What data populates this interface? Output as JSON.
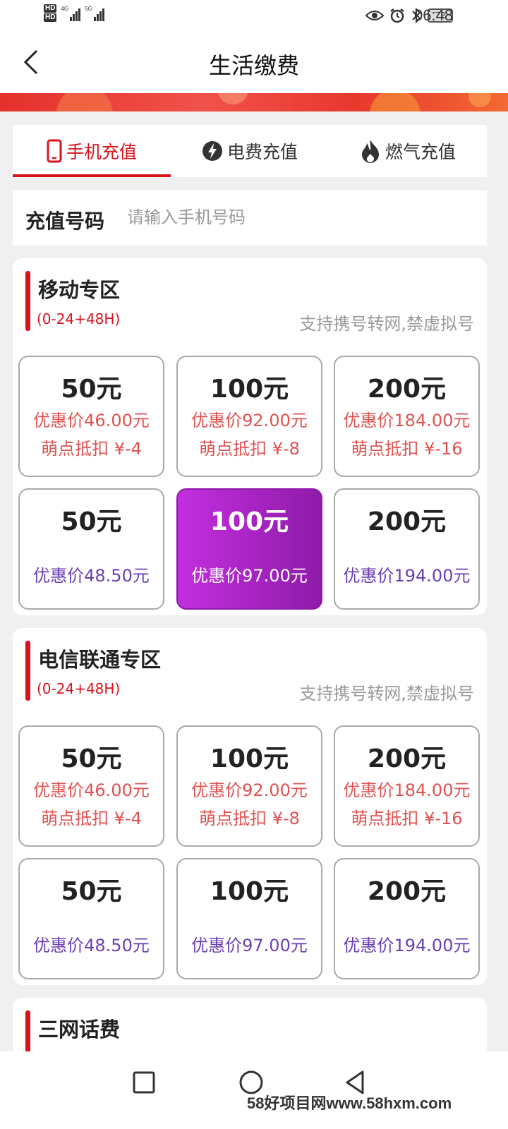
{
  "status": {
    "hd1": "HD",
    "hd2": "HD",
    "net1": "4G",
    "net2": "5G",
    "battery": "72",
    "time": "06:48"
  },
  "header": {
    "title": "生活缴费"
  },
  "tabs": [
    {
      "label": "手机充值",
      "icon": "phone-icon",
      "active": true
    },
    {
      "label": "电费充值",
      "icon": "lightning-icon",
      "active": false
    },
    {
      "label": "燃气充值",
      "icon": "flame-icon",
      "active": false
    }
  ],
  "recharge": {
    "label": "充值号码",
    "placeholder": "请输入手机号码",
    "value": ""
  },
  "sections": [
    {
      "title": "移动专区",
      "subtitle": "(0-24+48H)",
      "note": "支持携号转网,禁虚拟号",
      "cards_top": [
        {
          "amount": "50元",
          "price": "优惠价46.00元",
          "points": "萌点抵扣 ¥-4"
        },
        {
          "amount": "100元",
          "price": "优惠价92.00元",
          "points": "萌点抵扣 ¥-8"
        },
        {
          "amount": "200元",
          "price": "优惠价184.00元",
          "points": "萌点抵扣 ¥-16"
        }
      ],
      "cards_bottom": [
        {
          "amount": "50元",
          "price": "优惠价48.50元"
        },
        {
          "amount": "100元",
          "price": "优惠价97.00元",
          "selected": true
        },
        {
          "amount": "200元",
          "price": "优惠价194.00元"
        }
      ]
    },
    {
      "title": "电信联通专区",
      "subtitle": "(0-24+48H)",
      "note": "支持携号转网,禁虚拟号",
      "cards_top": [
        {
          "amount": "50元",
          "price": "优惠价46.00元",
          "points": "萌点抵扣 ¥-4"
        },
        {
          "amount": "100元",
          "price": "优惠价92.00元",
          "points": "萌点抵扣 ¥-8"
        },
        {
          "amount": "200元",
          "price": "优惠价184.00元",
          "points": "萌点抵扣 ¥-16"
        }
      ],
      "cards_bottom": [
        {
          "amount": "50元",
          "price": "优惠价48.50元"
        },
        {
          "amount": "100元",
          "price": "优惠价97.00元"
        },
        {
          "amount": "200元",
          "price": "优惠价194.00元"
        }
      ]
    },
    {
      "title": "三网话费"
    }
  ],
  "watermark": "58好项目网www.58hxm.com",
  "colors": {
    "accent": "#d7141e",
    "price": "#e05252",
    "purple": "#6a3fb5",
    "selected_start": "#c22fe0",
    "selected_end": "#8f1ba8"
  }
}
